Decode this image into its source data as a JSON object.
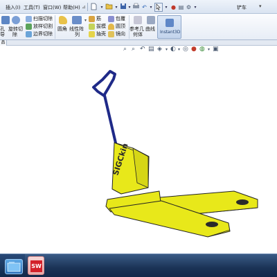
{
  "menubar": {
    "items": [
      "插入(I)",
      "工具(T)",
      "窗口(W)",
      "帮助(H)"
    ],
    "doc_title": "铲车",
    "title_caret": "▾"
  },
  "quick_access": {
    "new_icon": "new-document-icon",
    "open_icon": "open-folder-icon",
    "save_icon": "save-icon",
    "print_icon": "print-icon",
    "undo_icon": "undo-icon",
    "select_icon": "select-pointer-icon"
  },
  "ribbon": {
    "col1_a": "孔",
    "col1_b": "导",
    "col2_a": "旋转切",
    "col2_b": "除",
    "sweep_cut": "扫描切除",
    "loft_cut": "放样切割",
    "boundary_cut": "边界切除",
    "fillet": "圆角",
    "linear_pattern_a": "线性阵",
    "linear_pattern_b": "列",
    "rib": "筋",
    "draft": "拔模",
    "shell": "抽壳",
    "wrap": "包覆",
    "intersect": "圆顶",
    "mirror": "镜向",
    "ref_geometry_a": "参考几",
    "ref_geometry_b": "何体",
    "curves": "曲线",
    "instant3d": "Instant3D"
  },
  "tabstrip": {
    "tab": "品"
  },
  "view_toolbar": {
    "zoom_fit": "⌕",
    "zoom_area": "⌕",
    "prev_view": "↶",
    "section": "▤",
    "view_orient": "◈",
    "display_style": "◐",
    "hide_show": "◎",
    "appearance": "●",
    "scene": "◍",
    "settings": "▣"
  },
  "model": {
    "brand_text": "SIGCkin",
    "body_color": "#e8e81a",
    "handle_color": "#1f2a88",
    "edge_color": "#222222"
  },
  "taskbar": {
    "sw_logo": "SW"
  }
}
